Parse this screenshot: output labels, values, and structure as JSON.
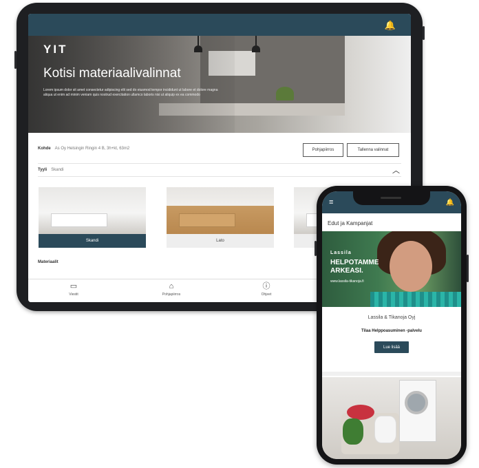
{
  "tablet": {
    "logo": "YIT",
    "hero_title": "Kotisi materiaalivalinnat",
    "hero_description": "Lorem ipsum dolor sit amet consectetur adipiscing elit sed do eiusmod tempor incididunt ut labore et dolore magna aliqua ut enim ad minim veniam quis nostrud exercitation ullamco laboris nisi ut aliquip ex ea commodo",
    "kohde_label": "Kohde",
    "kohde_value": "As Oy Helsingin Ringin 4 B, 3h+kt, 63m2",
    "button_1": "Pohjapiirros",
    "button_2": "Tallenna valinnat",
    "tyyli_label": "Tyyli",
    "tyyli_value": "Skandi",
    "style_cards": [
      {
        "label": "Skandi"
      },
      {
        "label": "Lato"
      },
      {
        "label": ""
      }
    ],
    "materiaalit_label": "Materiaalit",
    "nav": [
      {
        "label": "Viestit",
        "icon": "chat-icon"
      },
      {
        "label": "Pohjapiirros",
        "icon": "floorplan-icon"
      },
      {
        "label": "Ohjeet",
        "icon": "info-icon"
      }
    ]
  },
  "phone": {
    "section_heading": "Edut ja Kampanjat",
    "banner_logo": "Lassila",
    "banner_slogan": "HELPOTAMME ARKEASI.",
    "banner_site": "www.lassila-tikanoja.fi",
    "company": "Lassila & Tikanoja Oyj",
    "offer": "Tilaa Helppoasuminen -palvelu",
    "cta_label": "Lue lisää"
  }
}
